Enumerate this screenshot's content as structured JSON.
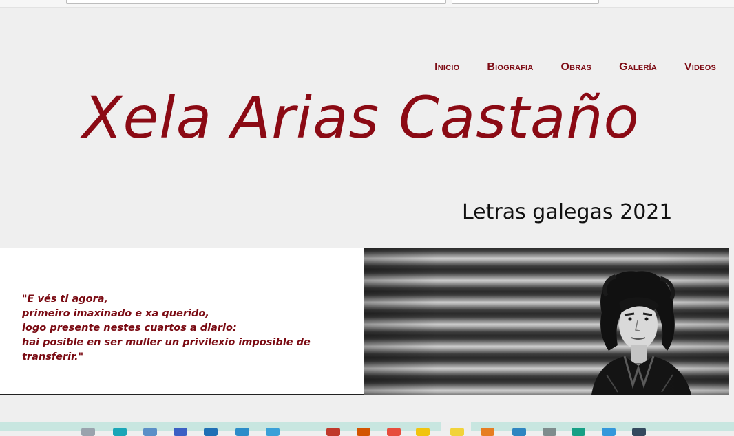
{
  "nav": {
    "items": [
      {
        "label": "Inicio"
      },
      {
        "label": "Biografia"
      },
      {
        "label": "Obras"
      },
      {
        "label": "Galería"
      },
      {
        "label": "Videos"
      }
    ]
  },
  "header": {
    "title": "Xela Arias Castaño",
    "subtitle": "Letras galegas 2021"
  },
  "quote": {
    "lines": [
      "\"E vés ti agora,",
      "primeiro imaxinado e xa querido,",
      "logo presente nestes cuartos a diario:",
      "hai posible en ser muller un privilexio imposible de",
      "transferir.\""
    ]
  },
  "colors": {
    "accent": "#8b0a14",
    "background": "#efefef",
    "taskbar": "#c8e6e0"
  },
  "taskbar": {
    "icons": [
      {
        "name": "generic-app-icon",
        "color": "#9aa3ad"
      },
      {
        "name": "browser-icon",
        "color": "#1aa6b7"
      },
      {
        "name": "file-manager-icon",
        "color": "#5b8fc7"
      },
      {
        "name": "document-icon",
        "color": "#3b5fc4"
      },
      {
        "name": "spreadsheet-icon",
        "color": "#1f6fb5"
      },
      {
        "name": "edit-icon",
        "color": "#2c8cc9"
      },
      {
        "name": "window-icon",
        "color": "#3aa0d8"
      },
      {
        "name": "home-icon",
        "color": "#c0392b"
      },
      {
        "name": "photo-icon",
        "color": "#d35400"
      },
      {
        "name": "chrome-icon",
        "color": "#e74c3c"
      },
      {
        "name": "folder-icon",
        "color": "#f1c40f"
      },
      {
        "name": "star-icon",
        "color": "#f1d33a"
      },
      {
        "name": "notes-icon",
        "color": "#e67e22"
      },
      {
        "name": "mail-icon",
        "color": "#2e86c1"
      },
      {
        "name": "calendar-icon",
        "color": "#7f8c8d"
      },
      {
        "name": "globe-icon",
        "color": "#16a085"
      },
      {
        "name": "chat-icon",
        "color": "#3498db"
      },
      {
        "name": "terminal-icon",
        "color": "#34495e"
      }
    ]
  }
}
